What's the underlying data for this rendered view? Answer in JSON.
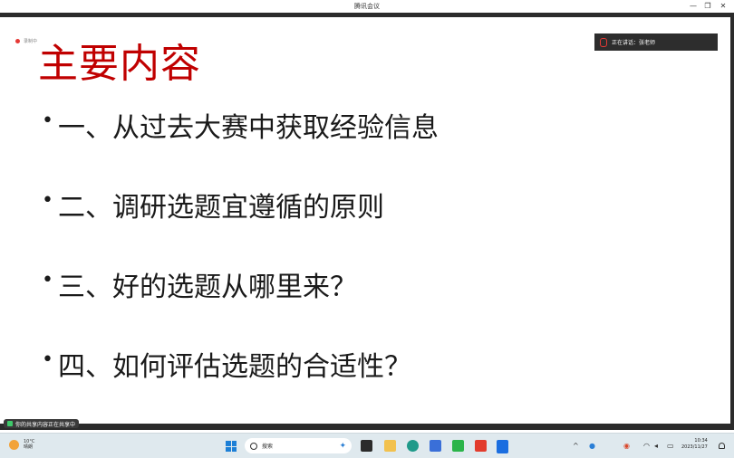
{
  "window": {
    "title": "腾讯会议",
    "minimize": "—",
    "restore": "❐",
    "close": "✕"
  },
  "recording": {
    "label": "录制中"
  },
  "speaker": {
    "label": "正在讲话：张老师"
  },
  "slide": {
    "title": "主要内容",
    "bullets": [
      "一、从过去大赛中获取经验信息",
      "二、调研选题宜遵循的原则",
      "三、好的选题从哪里来？",
      "四、如何评估选题的合适性？"
    ],
    "bullet_char": "•"
  },
  "share": {
    "label": "你的共享内容正在共享中"
  },
  "taskbar": {
    "weather_temp": "10°C",
    "weather_cond": "晴朗",
    "search_placeholder": "搜索",
    "clock_time": "10:34",
    "clock_date": "2023/11/27",
    "tray_chevron": "^",
    "colors": {
      "accent": "#1d7fd6",
      "title_red": "#c00000"
    }
  }
}
